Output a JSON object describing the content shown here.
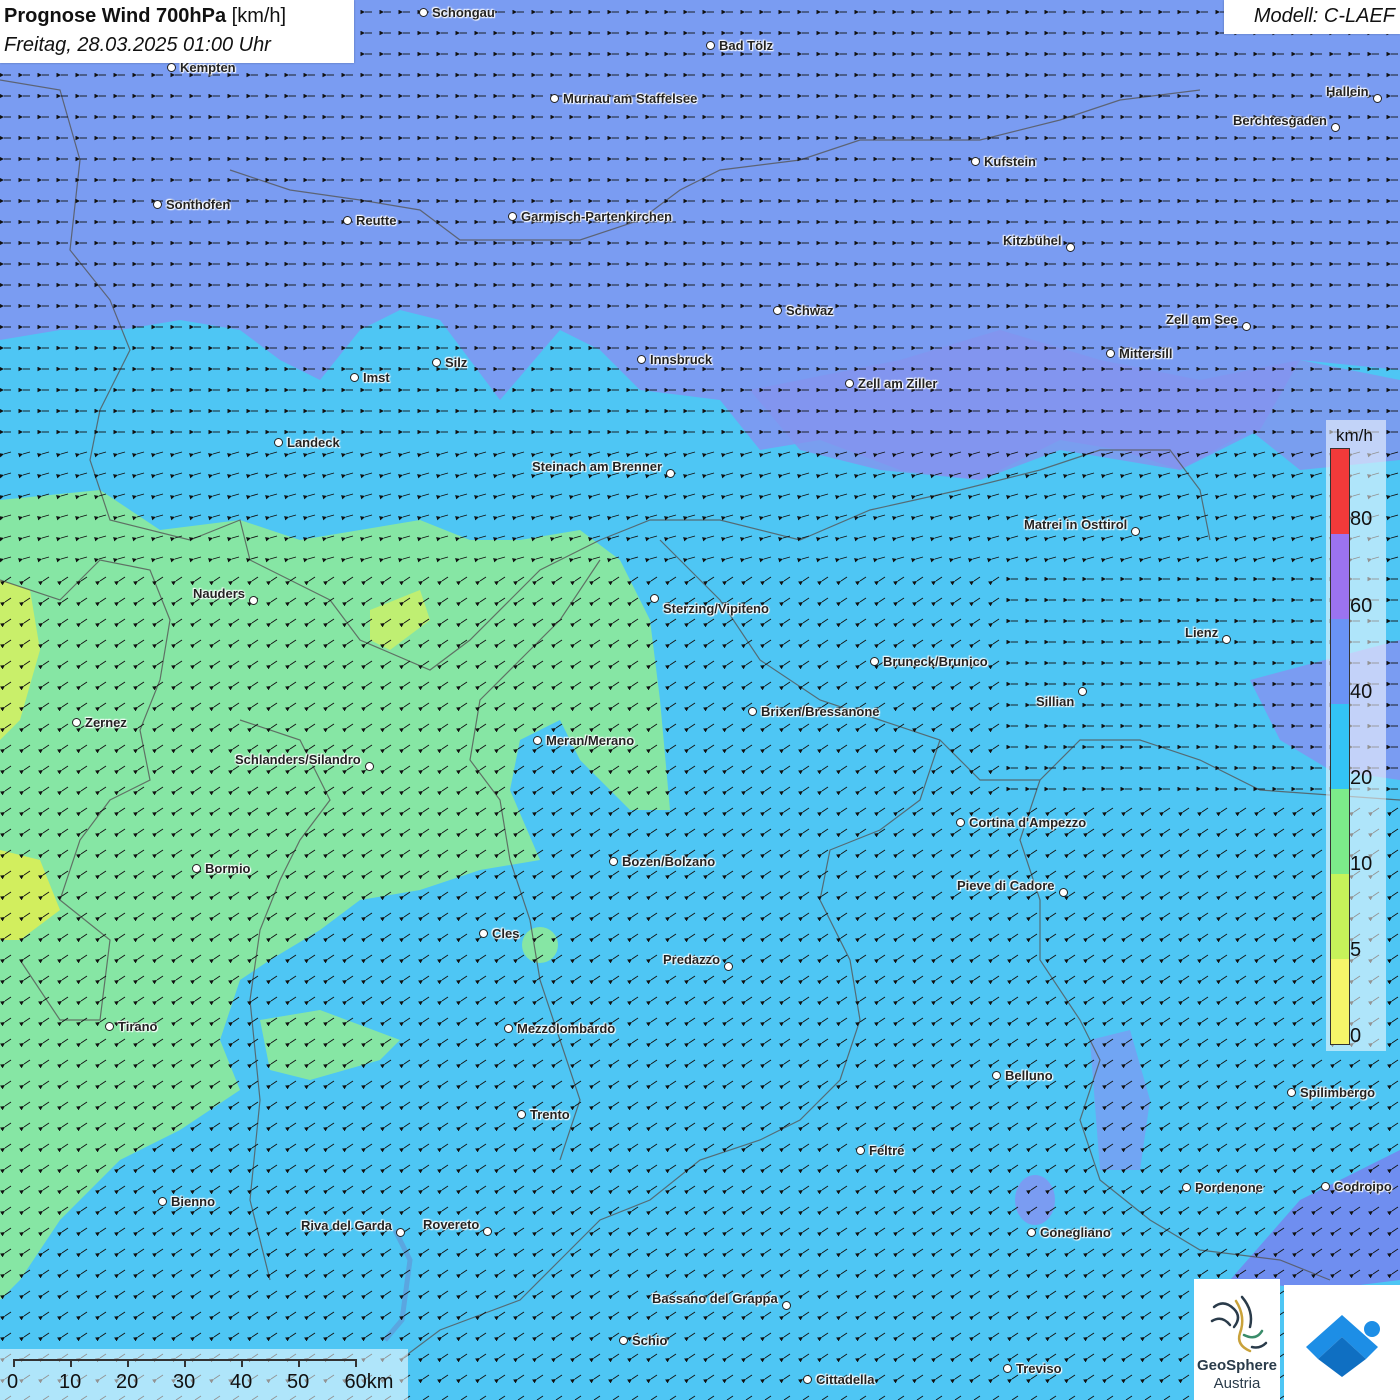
{
  "header": {
    "title": "Prognose Wind 700hPa",
    "unit": "[km/h]",
    "datetime": "Freitag, 28.03.2025 01:00 Uhr",
    "model": "Modell: C-LAEF"
  },
  "legend": {
    "unit": "km/h",
    "ticks": [
      "80",
      "60",
      "40",
      "20",
      "10",
      "5",
      "0"
    ],
    "colors": [
      "#f23a3a",
      "#9b73f0",
      "#6a93f5",
      "#33c4f5",
      "#7ceb8a",
      "#c7f35a",
      "#f6f56a"
    ]
  },
  "scale_bar": {
    "labels": [
      "0",
      "10",
      "20",
      "30",
      "40",
      "50",
      "60km"
    ]
  },
  "logos": {
    "geosphere_line1": "GeoSphere",
    "geosphere_line2": "Austria"
  },
  "wind": {
    "direction": "from north-east towards south-west",
    "zones": [
      "yellow-green over Swiss Engadin",
      "green over Vinschgau and upper Inn valley",
      "light blue over South Tyrol and Trentino",
      "violet-blue over northern Tyrol and Bavaria"
    ]
  },
  "cities": [
    {
      "name": "Schongau"
    },
    {
      "name": "Bad Tölz"
    },
    {
      "name": "Kempten"
    },
    {
      "name": "Murnau am Staffelsee"
    },
    {
      "name": "Hallein"
    },
    {
      "name": "Berchtesgaden"
    },
    {
      "name": "Kufstein"
    },
    {
      "name": "Sonthofen"
    },
    {
      "name": "Reutte"
    },
    {
      "name": "Garmisch-Partenkirchen"
    },
    {
      "name": "Kitzbühel"
    },
    {
      "name": "Schwaz"
    },
    {
      "name": "Zell am See"
    },
    {
      "name": "Mittersill"
    },
    {
      "name": "Innsbruck"
    },
    {
      "name": "Silz"
    },
    {
      "name": "Imst"
    },
    {
      "name": "Zell am Ziller"
    },
    {
      "name": "Landeck"
    },
    {
      "name": "Steinach am Brenner"
    },
    {
      "name": "Matrei in Osttirol"
    },
    {
      "name": "Nauders"
    },
    {
      "name": "Sterzing/Vipiteno"
    },
    {
      "name": "Lienz"
    },
    {
      "name": "Bruneck/Brunico"
    },
    {
      "name": "Sillian"
    },
    {
      "name": "Brixen/Bressanone"
    },
    {
      "name": "Zernez"
    },
    {
      "name": "Meran/Merano"
    },
    {
      "name": "Schlanders/Silandro"
    },
    {
      "name": "Cortina d'Ampezzo"
    },
    {
      "name": "Bozen/Bolzano"
    },
    {
      "name": "Bormio"
    },
    {
      "name": "Pieve di Cadore"
    },
    {
      "name": "Cles"
    },
    {
      "name": "Predazzo"
    },
    {
      "name": "Tirano"
    },
    {
      "name": "Mezzolombardo"
    },
    {
      "name": "Belluno"
    },
    {
      "name": "Spilimbergo"
    },
    {
      "name": "Trento"
    },
    {
      "name": "Feltre"
    },
    {
      "name": "Pordenone"
    },
    {
      "name": "Codroipo"
    },
    {
      "name": "Bienno"
    },
    {
      "name": "Riva del Garda"
    },
    {
      "name": "Rovereto"
    },
    {
      "name": "Conegliano"
    },
    {
      "name": "Bassano del Grappa"
    },
    {
      "name": "Schio"
    },
    {
      "name": "Treviso"
    },
    {
      "name": "Cittadella"
    }
  ]
}
